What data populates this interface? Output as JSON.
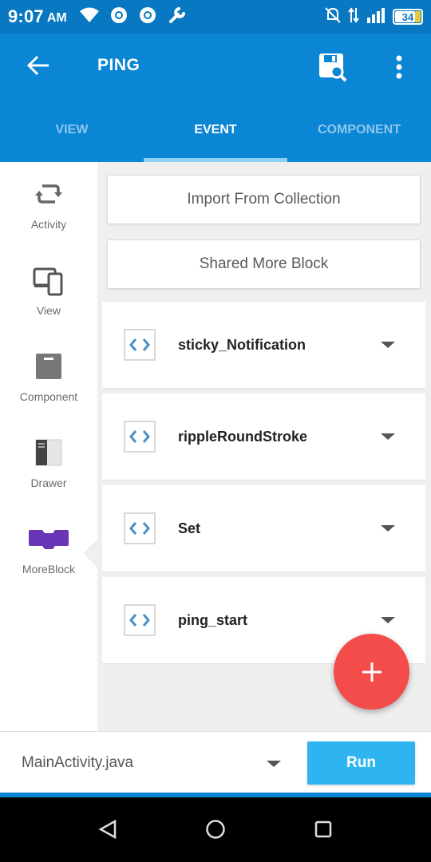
{
  "status_bar": {
    "time": "9:07",
    "ampm": "AM",
    "battery": "34"
  },
  "app_bar": {
    "title": "PING"
  },
  "tabs": [
    {
      "label": "VIEW"
    },
    {
      "label": "EVENT"
    },
    {
      "label": "COMPONENT"
    }
  ],
  "sidebar": {
    "items": [
      {
        "label": "Activity"
      },
      {
        "label": "View"
      },
      {
        "label": "Component"
      },
      {
        "label": "Drawer"
      },
      {
        "label": "MoreBlock"
      }
    ]
  },
  "content": {
    "import_label": "Import From Collection",
    "shared_label": "Shared More Block",
    "blocks": [
      {
        "name": "sticky_Notification"
      },
      {
        "name": "rippleRoundStroke"
      },
      {
        "name": "Set"
      },
      {
        "name": "ping_start"
      }
    ]
  },
  "bottom_bar": {
    "file": "MainActivity.java",
    "run_label": "Run"
  },
  "colors": {
    "primary": "#0a86d4",
    "status_bar": "#0878c2",
    "accent_fab": "#f44b4b",
    "run_button": "#2fb4f2",
    "moreblock": "#6a36b8"
  }
}
